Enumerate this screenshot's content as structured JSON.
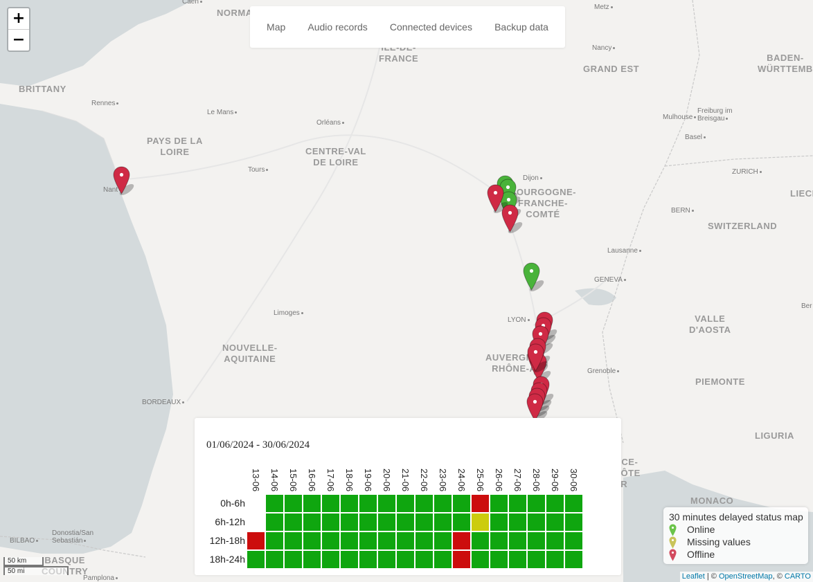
{
  "nav": {
    "items": [
      "Map",
      "Audio records",
      "Connected devices",
      "Backup data"
    ]
  },
  "zoom": {
    "in_label": "+",
    "out_label": "−"
  },
  "map_labels": {
    "regions": [
      {
        "id": "normandy",
        "text": "NORMANDY"
      },
      {
        "id": "ile",
        "text": "ÎLE-DE-\nFRANCE"
      },
      {
        "id": "grandest",
        "text": "GRAND EST"
      },
      {
        "id": "badenw",
        "text": "BADEN-\nWÜRTTEMB"
      },
      {
        "id": "brittany",
        "text": "BRITTANY"
      },
      {
        "id": "paysloire",
        "text": "PAYS DE LA\nLOIRE"
      },
      {
        "id": "centre",
        "text": "CENTRE-VAL\nDE LOIRE"
      },
      {
        "id": "bourgogne",
        "text": "BOURGOGNE-\nFRANCHE-\nCOMTÉ"
      },
      {
        "id": "switzerland",
        "text": "SWITZERLAND"
      },
      {
        "id": "nouvelle",
        "text": "NOUVELLE-\nAQUITAINE"
      },
      {
        "id": "auvergne",
        "text": "AUVERGNE-\nRHÔNE-A"
      },
      {
        "id": "valle",
        "text": "VALLE\nD'AOSTA"
      },
      {
        "id": "piemonte",
        "text": "PIEMONTE"
      },
      {
        "id": "liguria",
        "text": "LIGURIA"
      },
      {
        "id": "provence",
        "text": "PROVENCE-\nALPES-CÔTE\nD'AZUR"
      },
      {
        "id": "monaco",
        "text": "MONACO"
      },
      {
        "id": "basque",
        "text": "BASQUE\nCOUNTRY"
      }
    ],
    "cities": [
      {
        "id": "caen",
        "text": "Caen"
      },
      {
        "id": "metz",
        "text": "Metz"
      },
      {
        "id": "nancy",
        "text": "Nancy"
      },
      {
        "id": "rennes",
        "text": "Rennes"
      },
      {
        "id": "lemans",
        "text": "Le Mans"
      },
      {
        "id": "orleans",
        "text": "Orléans"
      },
      {
        "id": "freiburg",
        "text": "Freiburg im\nBreisgau"
      },
      {
        "id": "basel",
        "text": "Basel"
      },
      {
        "id": "mulhouse",
        "text": "Mulhouse"
      },
      {
        "id": "zurich",
        "text": "ZURICH"
      },
      {
        "id": "tours",
        "text": "Tours"
      },
      {
        "id": "dijon",
        "text": "Dijon"
      },
      {
        "id": "nantes",
        "text": "Nant"
      },
      {
        "id": "bern",
        "text": "BERN"
      },
      {
        "id": "lausanne",
        "text": "Lausanne"
      },
      {
        "id": "geneva",
        "text": "GENEVA"
      },
      {
        "id": "limoges",
        "text": "Limoges"
      },
      {
        "id": "lyon",
        "text": "LYON"
      },
      {
        "id": "grenoble",
        "text": "Grenoble"
      },
      {
        "id": "bordeaux",
        "text": "BORDEAUX"
      },
      {
        "id": "bilbao",
        "text": "BILBAO"
      },
      {
        "id": "donostia",
        "text": "Donostia/San\nSebastián"
      },
      {
        "id": "pamplona",
        "text": "Pamplona"
      },
      {
        "id": "liech",
        "text": "LIECH"
      },
      {
        "id": "bern2",
        "text": "Ber"
      }
    ]
  },
  "markers": [
    {
      "id": "m-nantes",
      "status": "offline"
    },
    {
      "id": "m-dijon-g1",
      "status": "online"
    },
    {
      "id": "m-dijon-g2",
      "status": "online"
    },
    {
      "id": "m-dijon-g3",
      "status": "online"
    },
    {
      "id": "m-dijon-r1",
      "status": "offline"
    },
    {
      "id": "m-dijon-r2",
      "status": "offline"
    },
    {
      "id": "m-bresse",
      "status": "online"
    },
    {
      "id": "m-lyon1",
      "status": "offline"
    },
    {
      "id": "m-lyon2",
      "status": "offline"
    },
    {
      "id": "m-lyon3",
      "status": "offline"
    },
    {
      "id": "m-lyon4",
      "status": "offline"
    },
    {
      "id": "m-lyon5",
      "status": "offline"
    },
    {
      "id": "m-lyon6",
      "status": "offline"
    },
    {
      "id": "m-lyon7",
      "status": "offline"
    },
    {
      "id": "m-south1",
      "status": "offline"
    },
    {
      "id": "m-south2",
      "status": "offline"
    },
    {
      "id": "m-south3",
      "status": "offline"
    },
    {
      "id": "m-south4",
      "status": "offline"
    }
  ],
  "panel": {
    "range": "01/06/2024 - 30/06/2024",
    "dates": [
      "13-06",
      "14-06",
      "15-06",
      "16-06",
      "17-06",
      "18-06",
      "19-06",
      "20-06",
      "21-06",
      "22-06",
      "23-06",
      "24-06",
      "25-06",
      "26-06",
      "27-06",
      "28-06",
      "29-06",
      "30-06"
    ],
    "rows": [
      "0h-6h",
      "6h-12h",
      "12h-18h",
      "18h-24h"
    ],
    "grid": [
      [
        "none",
        "online",
        "online",
        "online",
        "online",
        "online",
        "online",
        "online",
        "online",
        "online",
        "online",
        "online",
        "offline",
        "online",
        "online",
        "online",
        "online",
        "online"
      ],
      [
        "none",
        "online",
        "online",
        "online",
        "online",
        "online",
        "online",
        "online",
        "online",
        "online",
        "online",
        "online",
        "missing",
        "online",
        "online",
        "online",
        "online",
        "online"
      ],
      [
        "offline",
        "online",
        "online",
        "online",
        "online",
        "online",
        "online",
        "online",
        "online",
        "online",
        "online",
        "offline",
        "online",
        "online",
        "online",
        "online",
        "online",
        "online"
      ],
      [
        "online",
        "online",
        "online",
        "online",
        "online",
        "online",
        "online",
        "online",
        "online",
        "online",
        "online",
        "offline",
        "online",
        "online",
        "online",
        "online",
        "online",
        "online"
      ]
    ],
    "colors": {
      "online": "#0fa60f",
      "offline": "#cc0d0d",
      "missing": "#cccc0d"
    }
  },
  "legend": {
    "title": "30 minutes delayed status map",
    "items": [
      {
        "label": "Online",
        "color": "#6bc44a"
      },
      {
        "label": "Missing values",
        "color": "#c9c45a"
      },
      {
        "label": "Offline",
        "color": "#d34b5f"
      }
    ]
  },
  "scale": {
    "km": "50 km",
    "mi": "50 mi"
  },
  "attribution": {
    "leaflet": "Leaflet",
    "sep1": " | © ",
    "osm": "OpenStreetMap",
    "sep2": ", © ",
    "carto": "CARTO"
  },
  "marker_colors": {
    "online": "#49b33a",
    "offline": "#cf2a45",
    "missing": "#c9c44a"
  }
}
